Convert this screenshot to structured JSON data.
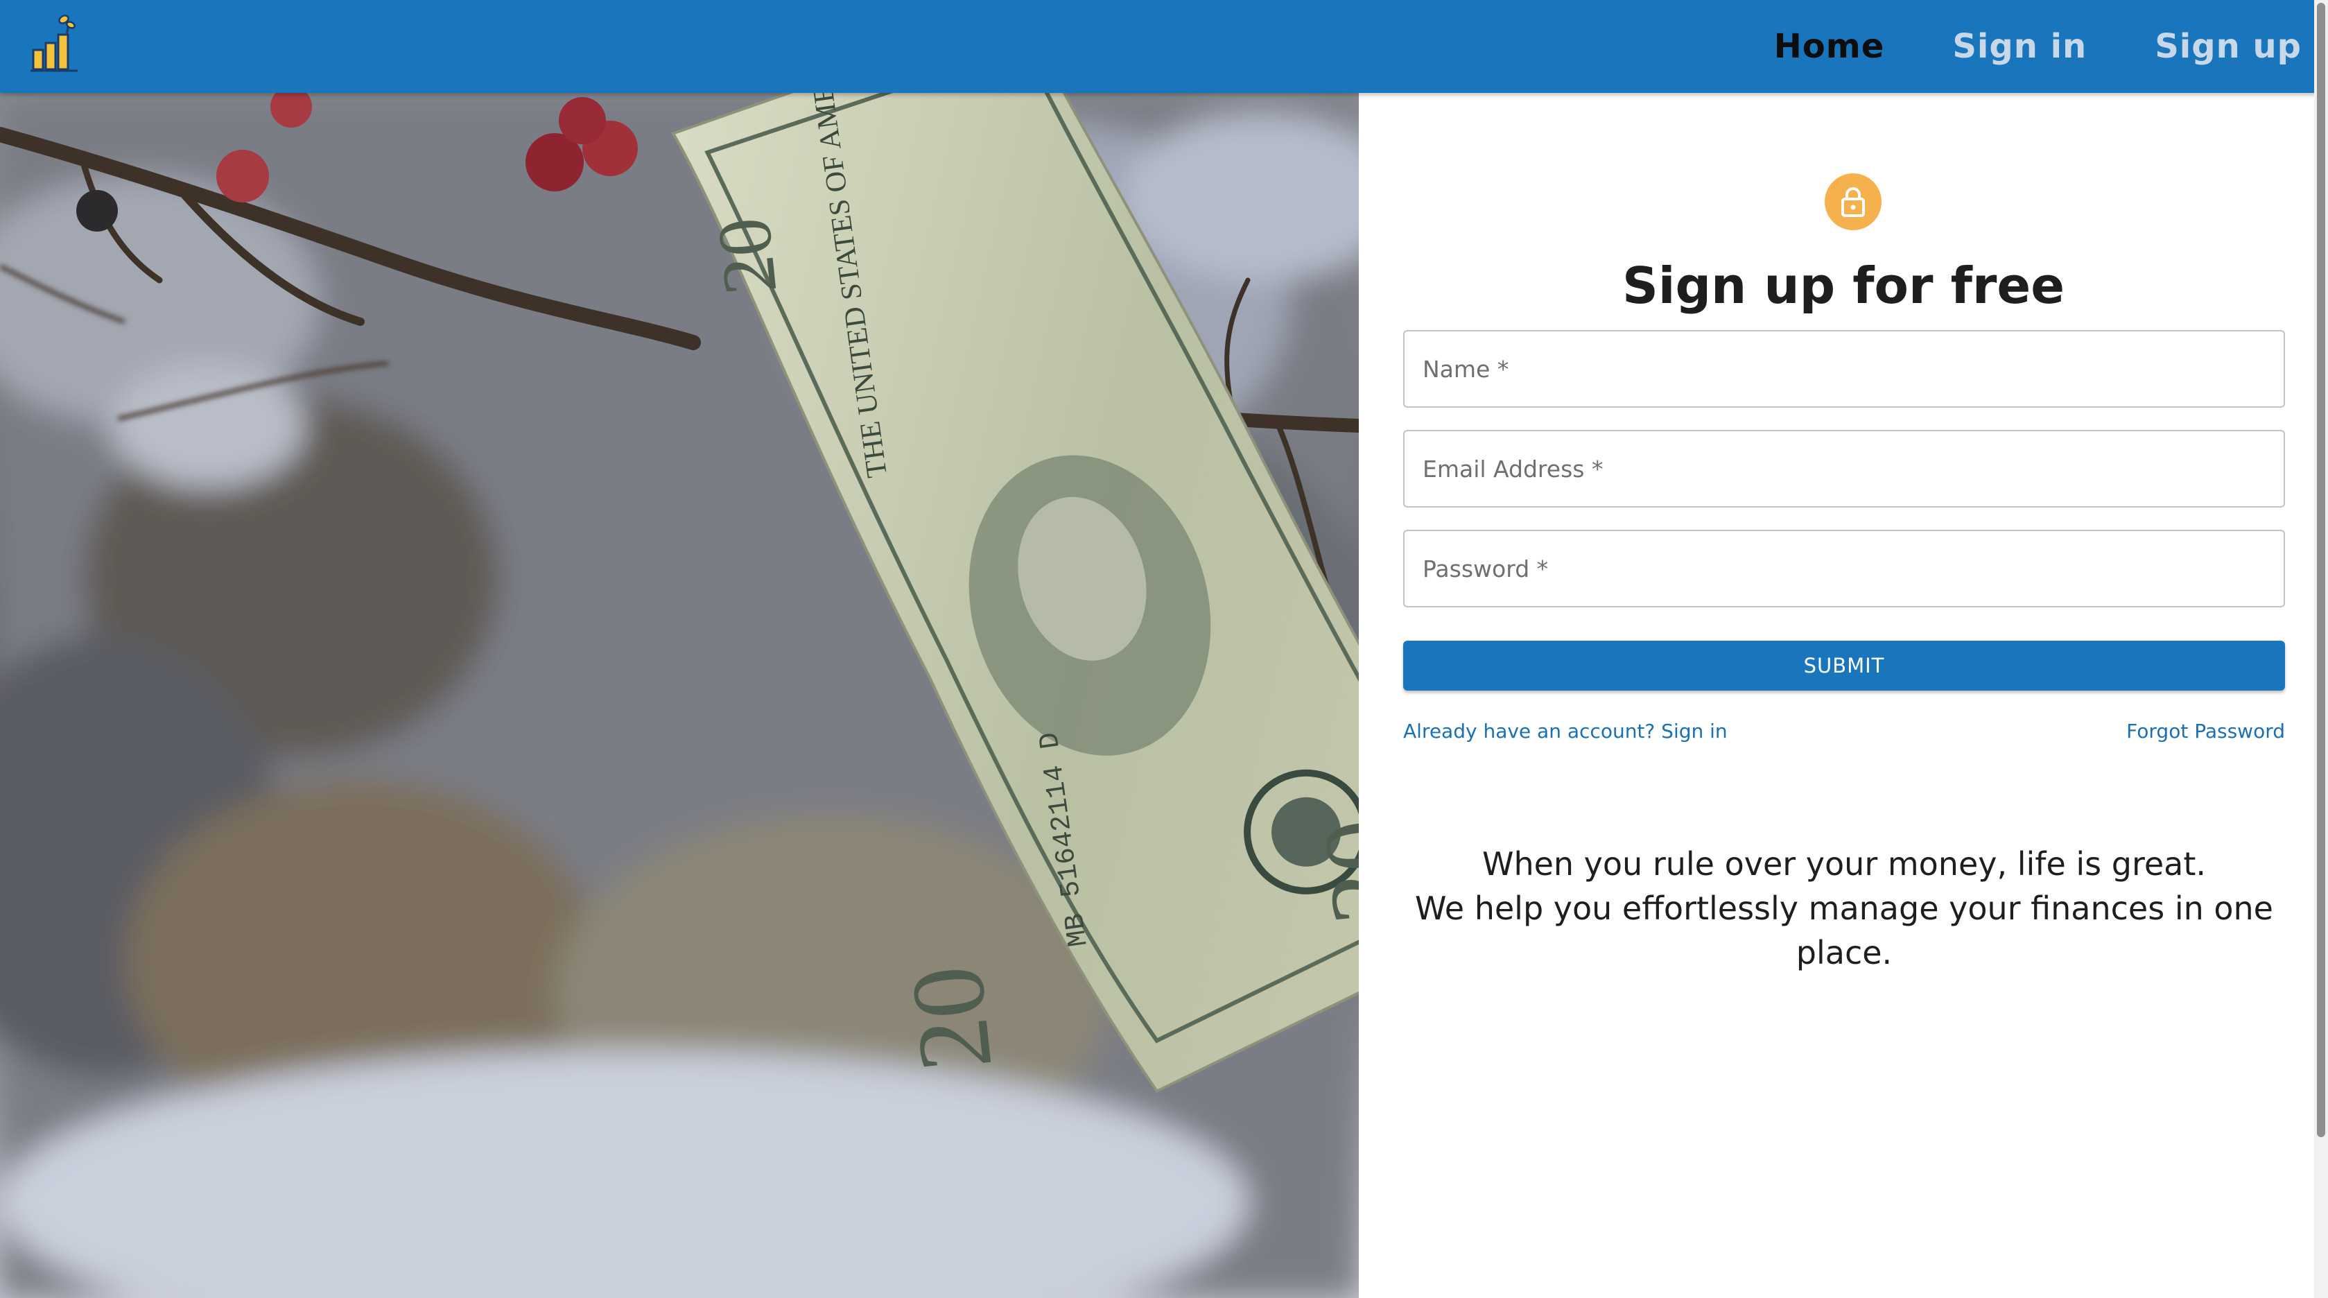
{
  "nav": {
    "logo_alt": "logo-icon",
    "links": [
      {
        "label": "Home",
        "active": true
      },
      {
        "label": "Sign in",
        "active": false
      },
      {
        "label": "Sign up",
        "active": false
      }
    ]
  },
  "hero": {
    "icon": "hanging-dollar-bill-photo"
  },
  "form": {
    "lock_icon": "lock-icon",
    "title": "Sign up for free",
    "name_placeholder": "Name *",
    "email_placeholder": "Email Address *",
    "password_placeholder": "Password *",
    "submit_label": "SUBMIT",
    "signin_link": "Already have an account? Sign in",
    "forgot_link": "Forgot Password"
  },
  "tagline": {
    "line1": "When you rule over your money, life is great.",
    "line2": "We help you effortlessly manage your finances in one place."
  },
  "colors": {
    "appbar": "#1976bd",
    "accent": "#f5b14d",
    "link": "#1a70b3"
  }
}
